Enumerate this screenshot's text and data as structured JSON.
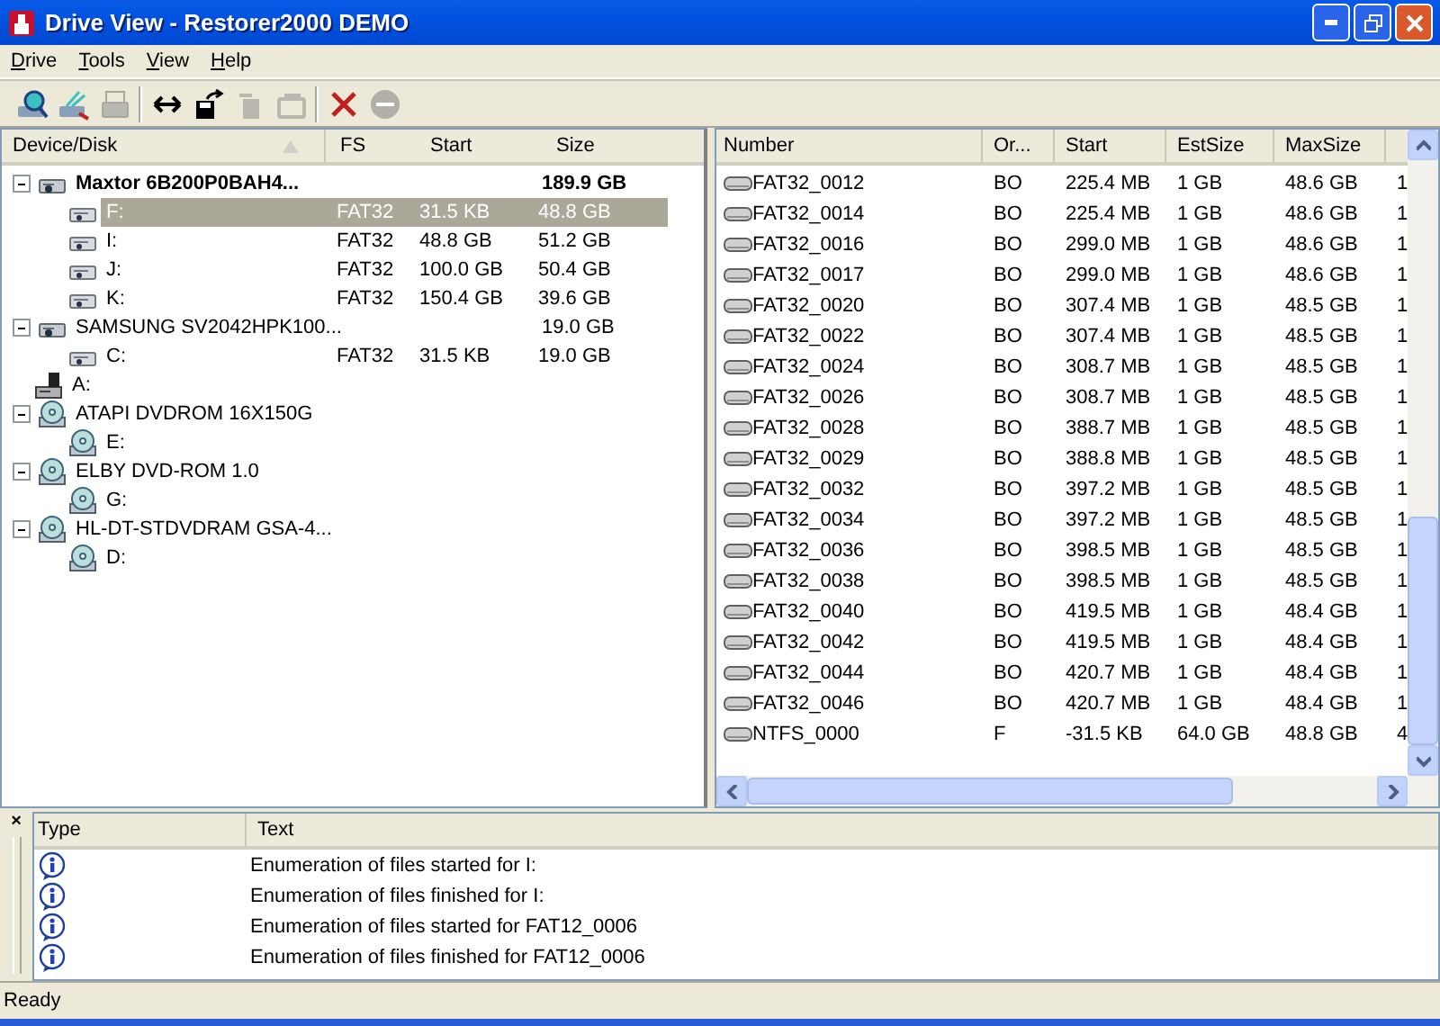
{
  "window": {
    "title": "Drive View - Restorer2000 DEMO"
  },
  "menu": [
    "Drive",
    "Tools",
    "View",
    "Help"
  ],
  "toolbar": [
    [
      {
        "kind": "find",
        "disabled": false
      },
      {
        "kind": "scan",
        "disabled": false
      },
      {
        "kind": "print",
        "disabled": true
      }
    ],
    [
      {
        "kind": "swap",
        "disabled": false
      },
      {
        "kind": "save",
        "disabled": false
      },
      {
        "kind": "copy",
        "disabled": true
      },
      {
        "kind": "export",
        "disabled": true
      }
    ],
    [
      {
        "kind": "delete",
        "disabled": false
      },
      {
        "kind": "stop",
        "disabled": true
      }
    ]
  ],
  "tree": {
    "columns": [
      "Device/Disk",
      "FS",
      "Start",
      "Size"
    ],
    "items": [
      {
        "kind": "hdd",
        "name": "Maxtor 6B200P0BAH4...",
        "size": "189.9 GB",
        "bold": true,
        "selected": false,
        "expanded": true,
        "children": [
          {
            "kind": "partition",
            "name": "F:",
            "fs": "FAT32",
            "start": "31.5 KB",
            "size": "48.8 GB",
            "bold": false,
            "selected": true
          },
          {
            "kind": "partition",
            "name": "I:",
            "fs": "FAT32",
            "start": "48.8 GB",
            "size": "51.2 GB",
            "bold": false,
            "selected": false
          },
          {
            "kind": "partition",
            "name": "J:",
            "fs": "FAT32",
            "start": "100.0 GB",
            "size": "50.4 GB",
            "bold": false,
            "selected": false
          },
          {
            "kind": "partition",
            "name": "K:",
            "fs": "FAT32",
            "start": "150.4 GB",
            "size": "39.6 GB",
            "bold": false,
            "selected": false
          }
        ]
      },
      {
        "kind": "hdd",
        "name": "SAMSUNG SV2042HPK100...",
        "size": "19.0 GB",
        "bold": false,
        "selected": false,
        "expanded": true,
        "children": [
          {
            "kind": "partition",
            "name": "C:",
            "fs": "FAT32",
            "start": "31.5 KB",
            "size": "19.0 GB",
            "bold": false,
            "selected": false
          }
        ]
      },
      {
        "kind": "floppy",
        "name": "A:",
        "bold": false,
        "selected": false
      },
      {
        "kind": "cdrom",
        "name": "ATAPI DVDROM 16X150G",
        "bold": false,
        "selected": false,
        "expanded": true,
        "children": [
          {
            "kind": "cdrom",
            "name": "E:",
            "bold": false,
            "selected": false
          }
        ]
      },
      {
        "kind": "cdrom",
        "name": "ELBY DVD-ROM 1.0",
        "bold": false,
        "selected": false,
        "expanded": true,
        "children": [
          {
            "kind": "cdrom",
            "name": "G:",
            "bold": false,
            "selected": false
          }
        ]
      },
      {
        "kind": "cdrom",
        "name": "HL-DT-STDVDRAM GSA-4...",
        "bold": false,
        "selected": false,
        "expanded": true,
        "children": [
          {
            "kind": "cdrom",
            "name": "D:",
            "bold": false,
            "selected": false
          }
        ]
      }
    ]
  },
  "table": {
    "columns": [
      "Number",
      "Or...",
      "Start",
      "EstSize",
      "MaxSize"
    ],
    "rows": [
      [
        "FAT32_0012",
        "BO",
        "225.4 MB",
        "1 GB",
        "48.6 GB",
        "1"
      ],
      [
        "FAT32_0014",
        "BO",
        "225.4 MB",
        "1 GB",
        "48.6 GB",
        "1"
      ],
      [
        "FAT32_0016",
        "BO",
        "299.0 MB",
        "1 GB",
        "48.6 GB",
        "1"
      ],
      [
        "FAT32_0017",
        "BO",
        "299.0 MB",
        "1 GB",
        "48.6 GB",
        "1"
      ],
      [
        "FAT32_0020",
        "BO",
        "307.4 MB",
        "1 GB",
        "48.5 GB",
        "1"
      ],
      [
        "FAT32_0022",
        "BO",
        "307.4 MB",
        "1 GB",
        "48.5 GB",
        "1"
      ],
      [
        "FAT32_0024",
        "BO",
        "308.7 MB",
        "1 GB",
        "48.5 GB",
        "1"
      ],
      [
        "FAT32_0026",
        "BO",
        "308.7 MB",
        "1 GB",
        "48.5 GB",
        "1"
      ],
      [
        "FAT32_0028",
        "BO",
        "388.7 MB",
        "1 GB",
        "48.5 GB",
        "1"
      ],
      [
        "FAT32_0029",
        "BO",
        "388.8 MB",
        "1 GB",
        "48.5 GB",
        "1"
      ],
      [
        "FAT32_0032",
        "BO",
        "397.2 MB",
        "1 GB",
        "48.5 GB",
        "1"
      ],
      [
        "FAT32_0034",
        "BO",
        "397.2 MB",
        "1 GB",
        "48.5 GB",
        "1"
      ],
      [
        "FAT32_0036",
        "BO",
        "398.5 MB",
        "1 GB",
        "48.5 GB",
        "1"
      ],
      [
        "FAT32_0038",
        "BO",
        "398.5 MB",
        "1 GB",
        "48.5 GB",
        "1"
      ],
      [
        "FAT32_0040",
        "BO",
        "419.5 MB",
        "1 GB",
        "48.4 GB",
        "1"
      ],
      [
        "FAT32_0042",
        "BO",
        "419.5 MB",
        "1 GB",
        "48.4 GB",
        "1"
      ],
      [
        "FAT32_0044",
        "BO",
        "420.7 MB",
        "1 GB",
        "48.4 GB",
        "1"
      ],
      [
        "FAT32_0046",
        "BO",
        "420.7 MB",
        "1 GB",
        "48.4 GB",
        "1"
      ],
      [
        "NTFS_0000",
        "F",
        "-31.5 KB",
        "64.0 GB",
        "48.8 GB",
        "4"
      ]
    ]
  },
  "log": {
    "close": "×",
    "columns": [
      "Type",
      "Text"
    ],
    "entries": [
      {
        "kind": "info",
        "text": "Enumeration of files started for I:"
      },
      {
        "kind": "info",
        "text": "Enumeration of files finished for I:"
      },
      {
        "kind": "info",
        "text": "Enumeration of files started for FAT12_0006"
      },
      {
        "kind": "info",
        "text": "Enumeration of files finished for FAT12_0006"
      }
    ]
  },
  "status_bar": "Ready"
}
